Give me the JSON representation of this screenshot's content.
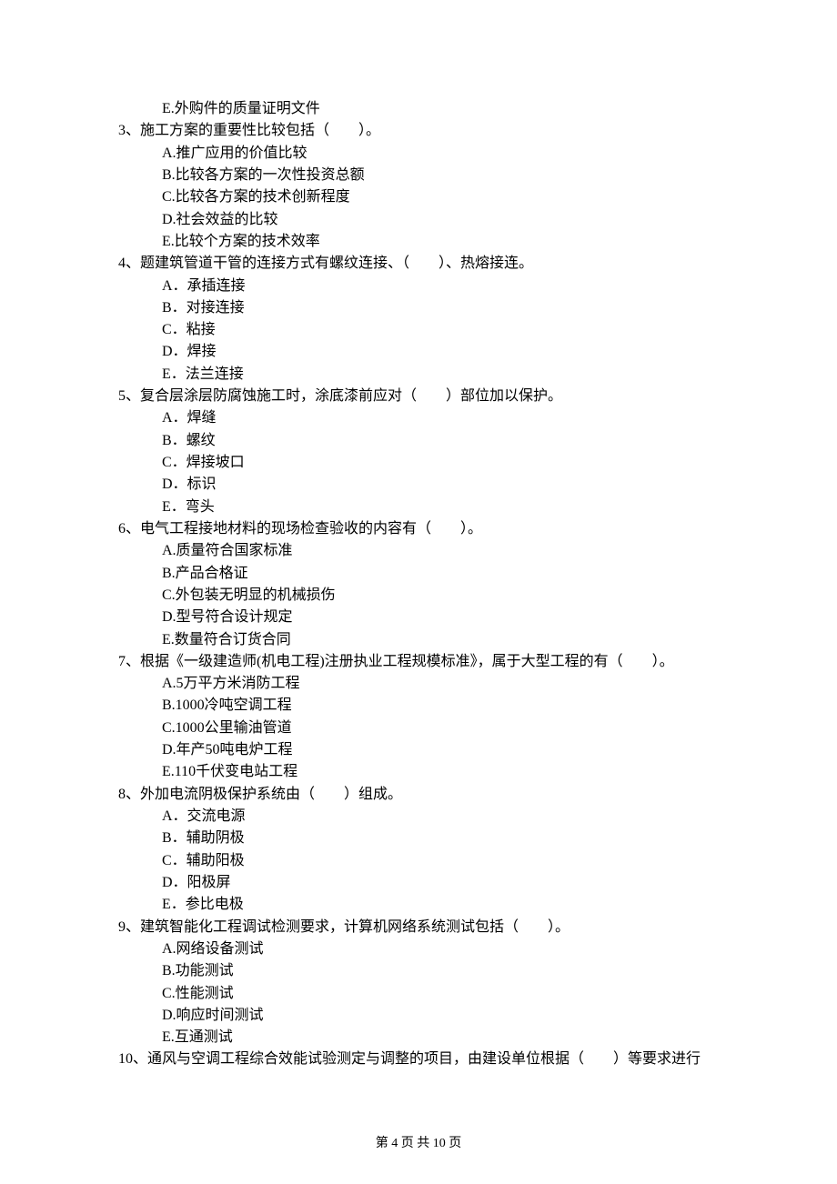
{
  "prev_option": "E.外购件的质量证明文件",
  "questions": [
    {
      "num": "3、",
      "stem": "施工方案的重要性比较包括（　　）。",
      "options": [
        "A.推广应用的价值比较",
        "B.比较各方案的一次性投资总额",
        "C.比较各方案的技术创新程度",
        "D.社会效益的比较",
        "E.比较个方案的技术效率"
      ]
    },
    {
      "num": "4、",
      "stem": "题建筑管道干管的连接方式有螺纹连接、（　　）、热熔接连。",
      "options": [
        "A．承插连接",
        "B．对接连接",
        "C．粘接",
        "D．焊接",
        "E．法兰连接"
      ]
    },
    {
      "num": "5、",
      "stem": "复合层涂层防腐蚀施工时，涂底漆前应对（　　）部位加以保护。",
      "options": [
        "A．焊缝",
        "B．螺纹",
        "C．焊接坡口",
        "D．标识",
        "E．弯头"
      ]
    },
    {
      "num": "6、",
      "stem": "电气工程接地材料的现场检查验收的内容有（　　）。",
      "options": [
        "A.质量符合国家标准",
        "B.产品合格证",
        "C.外包装无明显的机械损伤",
        "D.型号符合设计规定",
        "E.数量符合订货合同"
      ]
    },
    {
      "num": "7、",
      "stem": "根据《一级建造师(机电工程)注册执业工程规模标准》，属于大型工程的有（　　）。",
      "options": [
        "A.5万平方米消防工程",
        "B.1000冷吨空调工程",
        "C.1000公里输油管道",
        "D.年产50吨电炉工程",
        "E.110千伏变电站工程"
      ]
    },
    {
      "num": "8、",
      "stem": "外加电流阴极保护系统由（　　）组成。",
      "options": [
        "A．交流电源",
        "B．辅助阴极",
        "C．辅助阳极",
        "D．阳极屏",
        "E．参比电极"
      ]
    },
    {
      "num": "9、",
      "stem": "建筑智能化工程调试检测要求，计算机网络系统测试包括（　　）。",
      "options": [
        "A.网络设备测试",
        "B.功能测试",
        "C.性能测试",
        "D.响应时间测试",
        "E.互通测试"
      ]
    },
    {
      "num": "10、",
      "stem": "通风与空调工程综合效能试验测定与调整的项目，由建设单位根据（　　）等要求进行",
      "options": []
    }
  ],
  "footer": "第 4 页 共 10 页"
}
